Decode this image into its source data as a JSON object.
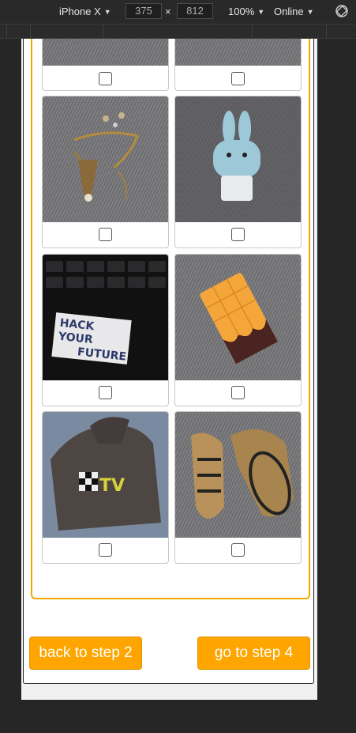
{
  "devtools": {
    "device": "iPhone X",
    "width": "375",
    "height": "812",
    "times_symbol": "×",
    "zoom": "100%",
    "network": "Online",
    "rotate_icon": "rotate-device-icon"
  },
  "gallery": {
    "accent_color": "#f0a800",
    "items": [
      {
        "id": "item-1",
        "photo": "orange-object-on-fur",
        "checked": false
      },
      {
        "id": "item-2",
        "photo": "dark-object-on-fur",
        "checked": false
      },
      {
        "id": "item-3",
        "photo": "jewelry-on-fur",
        "checked": false
      },
      {
        "id": "item-4",
        "photo": "bunny-bottle-on-fur",
        "checked": false
      },
      {
        "id": "item-5",
        "photo": "hack-your-future-sticker-on-laptop",
        "checked": false
      },
      {
        "id": "item-6",
        "photo": "chocolate-bar-palette",
        "checked": false
      },
      {
        "id": "item-7",
        "photo": "mtv-hoodie",
        "checked": false
      },
      {
        "id": "item-8",
        "photo": "gold-sneakers",
        "checked": false
      }
    ],
    "sticker_text": [
      "HACK",
      "YOUR",
      "FUTURE"
    ],
    "hoodie_logo": "TV"
  },
  "nav": {
    "back_label": "back to step 2",
    "next_label": "go to step 4",
    "button_color": "#ffa500"
  }
}
